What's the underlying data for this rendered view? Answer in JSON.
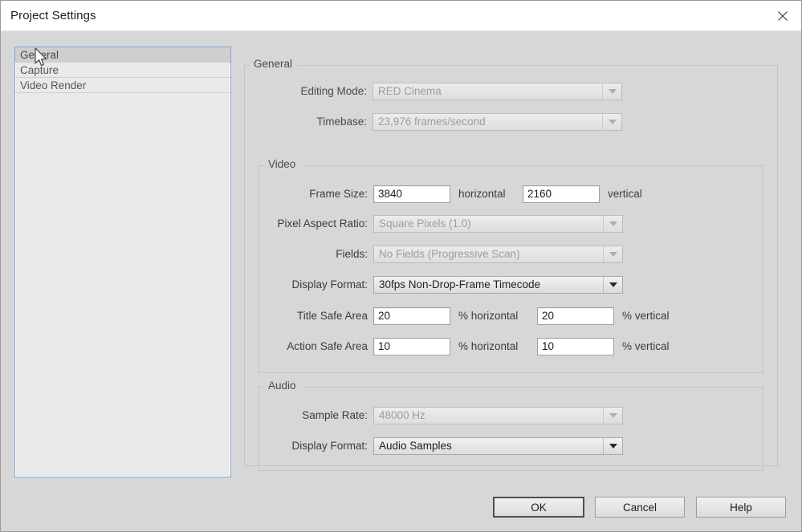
{
  "window": {
    "title": "Project Settings",
    "close_icon": "close-icon"
  },
  "sidebar": {
    "items": [
      {
        "label": "General",
        "selected": true
      },
      {
        "label": "Capture",
        "selected": false
      },
      {
        "label": "Video Render",
        "selected": false
      }
    ]
  },
  "general_group": {
    "title": "General",
    "fields": [
      {
        "label": "Editing Mode:",
        "value": "RED Cinema",
        "disabled": true
      },
      {
        "label": "Timebase:",
        "value": "23,976 frames/second",
        "disabled": true
      }
    ]
  },
  "video_group": {
    "title": "Video",
    "frame_size": {
      "label": "Frame Size:",
      "horizontal_value": "3840",
      "horizontal_suffix": "horizontal",
      "vertical_value": "2160",
      "vertical_suffix": "vertical"
    },
    "pixel_aspect_ratio": {
      "label": "Pixel Aspect Ratio:",
      "value": "Square Pixels (1.0)",
      "disabled": true
    },
    "fields_scan": {
      "label": "Fields:",
      "value": "No Fields (Progressive Scan)",
      "disabled": true
    },
    "display_format": {
      "label": "Display Format:",
      "value": "30fps Non-Drop-Frame Timecode",
      "disabled": false
    },
    "title_safe": {
      "label": "Title Safe Area",
      "horizontal_value": "20",
      "horizontal_suffix": "% horizontal",
      "vertical_value": "20",
      "vertical_suffix": "% vertical"
    },
    "action_safe": {
      "label": "Action Safe Area",
      "horizontal_value": "10",
      "horizontal_suffix": "% horizontal",
      "vertical_value": "10",
      "vertical_suffix": "% vertical"
    }
  },
  "audio_group": {
    "title": "Audio",
    "sample_rate": {
      "label": "Sample Rate:",
      "value": "48000 Hz",
      "disabled": true
    },
    "display_format": {
      "label": "Display Format:",
      "value": "Audio Samples",
      "disabled": false
    }
  },
  "footer": {
    "ok_label": "OK",
    "cancel_label": "Cancel",
    "help_label": "Help"
  },
  "colors": {
    "window_bg": "#d7d7d7",
    "titlebar_bg": "#ffffff",
    "list_selection": "#cfcfcf",
    "focus_border": "#7fa9d0",
    "groupbox_border": "#c3c3c3"
  }
}
